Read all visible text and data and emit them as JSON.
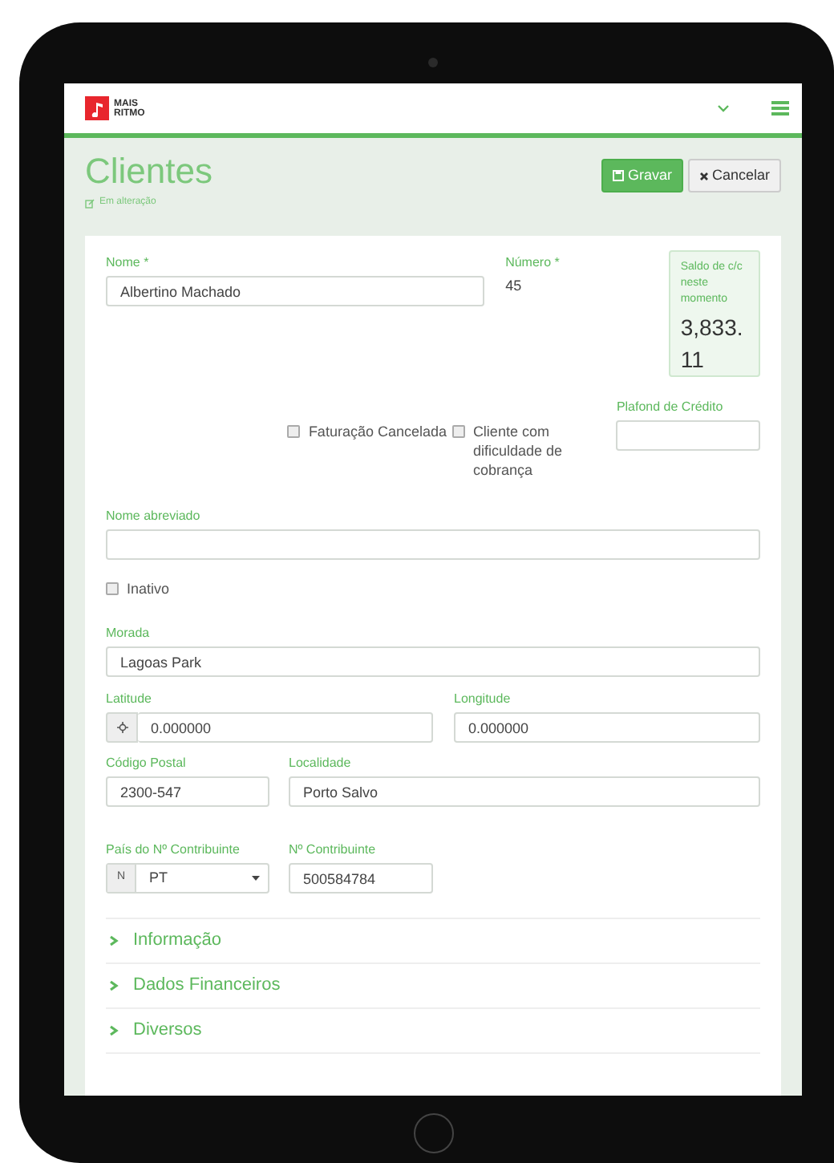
{
  "header": {
    "logo_lines": [
      "MAIS",
      "RITMO"
    ]
  },
  "page": {
    "title": "Clientes",
    "status": "Em alteração"
  },
  "buttons": [
    {
      "label": "Gravar",
      "kind": "primary"
    },
    {
      "label": "Cancelar",
      "kind": "default"
    }
  ],
  "nome": {
    "label": "Nome *",
    "value": "Albertino Machado"
  },
  "numero": {
    "label": "Número *",
    "value": "45"
  },
  "saldo": {
    "label": "Saldo de c/c neste momento",
    "value": "3,833.11"
  },
  "plafond": {
    "label": "Plafond de Crédito"
  },
  "checkboxes": [
    {
      "label": "Faturação Cancelada",
      "checked": false
    },
    {
      "label": "Cliente com dificuldade de cobrança",
      "checked": false
    }
  ],
  "nome_abreviado": {
    "label": "Nome abreviado"
  },
  "inativo": {
    "label": "Inativo",
    "checked": false
  },
  "morada": {
    "label": "Morada",
    "value": "Lagoas Park"
  },
  "latitude": {
    "label": "Latitude",
    "value": "0.000000"
  },
  "longitude": {
    "label": "Longitude",
    "value": "0.000000"
  },
  "codigo_postal": {
    "label": "Código Postal",
    "value": "2300-547"
  },
  "localidade": {
    "label": "Localidade",
    "value": "Porto Salvo"
  },
  "pais_contribuinte": {
    "label": "País do Nº Contribuinte",
    "prefix": "N",
    "value": "PT"
  },
  "contribuinte": {
    "label": "Nº Contribuinte",
    "value": "500584784"
  },
  "sections": [
    {
      "label": "Informação",
      "expanded": false
    },
    {
      "label": "Dados Financeiros",
      "expanded": false
    },
    {
      "label": "Diversos",
      "expanded": false
    }
  ]
}
